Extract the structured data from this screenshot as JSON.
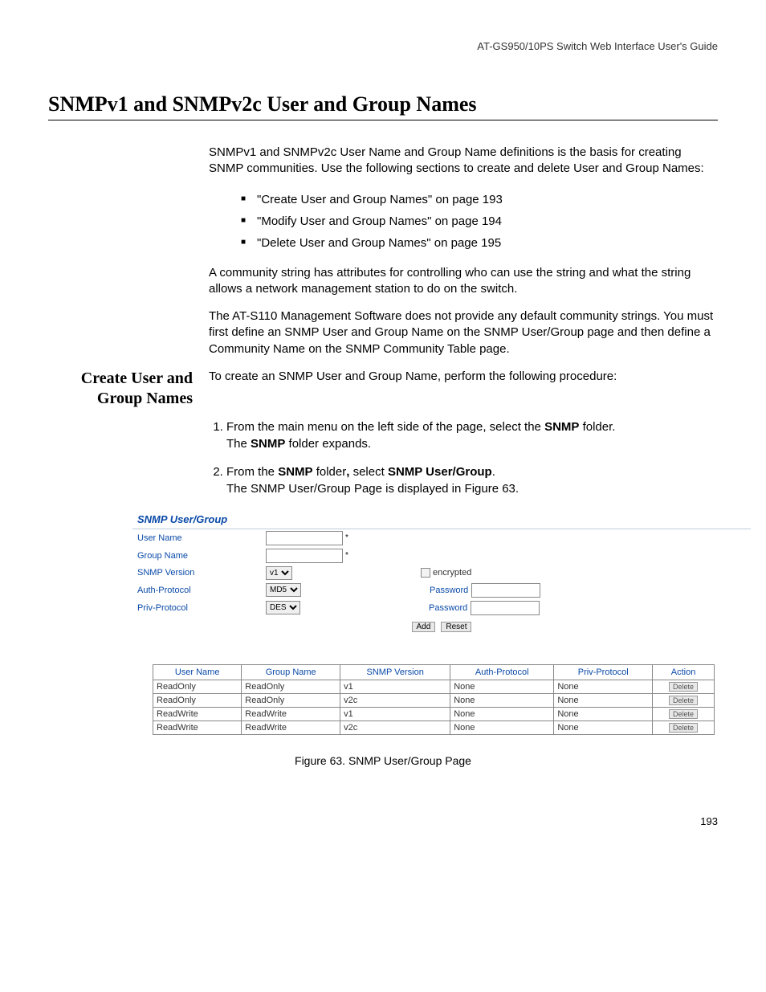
{
  "header": "AT-GS950/10PS Switch Web Interface User's Guide",
  "title": "SNMPv1 and SNMPv2c User and Group Names",
  "intro": "SNMPv1 and SNMPv2c User Name and Group Name definitions is the basis for creating SNMP communities. Use the following sections to create and delete User and Group Names:",
  "bullets": [
    "\"Create User and Group Names\" on page 193",
    "\"Modify User and Group Names\" on page 194",
    "\"Delete User and Group Names\" on page 195"
  ],
  "para2": "A community string has attributes for controlling who can use the string and what the string allows a network management station to do on the switch.",
  "para3": "The AT-S110 Management Software does not provide any default community strings. You must first define an SNMP User and Group Name on the SNMP User/Group page and then define a Community Name on the SNMP Community Table page.",
  "sub_heading": "Create User and Group Names",
  "sub_intro": "To create an SNMP User and Group Name, perform the following procedure:",
  "step1_a": "From the main menu on the left side of the page, select the ",
  "step1_bold1": "SNMP",
  "step1_b": " folder.",
  "step1_c": "The ",
  "step1_bold2": "SNMP",
  "step1_d": " folder expands.",
  "step2_a": "From the ",
  "step2_bold1": "SNMP",
  "step2_b": " folder",
  "step2_boldcomma": ",",
  "step2_c": " select ",
  "step2_bold2": "SNMP User/Group",
  "step2_d": ".",
  "step2_e": "The SNMP User/Group Page is displayed in Figure 63.",
  "shot": {
    "title": "SNMP User/Group",
    "labels": {
      "user": "User Name",
      "group": "Group Name",
      "version": "SNMP Version",
      "auth": "Auth-Protocol",
      "priv": "Priv-Protocol",
      "encrypted": "encrypted",
      "password": "Password"
    },
    "selects": {
      "version": "v1",
      "auth": "MD5",
      "priv": "DES"
    },
    "buttons": {
      "add": "Add",
      "reset": "Reset"
    }
  },
  "table": {
    "headers": [
      "User Name",
      "Group Name",
      "SNMP Version",
      "Auth-Protocol",
      "Priv-Protocol",
      "Action"
    ],
    "rows": [
      [
        "ReadOnly",
        "ReadOnly",
        "v1",
        "None",
        "None"
      ],
      [
        "ReadOnly",
        "ReadOnly",
        "v2c",
        "None",
        "None"
      ],
      [
        "ReadWrite",
        "ReadWrite",
        "v1",
        "None",
        "None"
      ],
      [
        "ReadWrite",
        "ReadWrite",
        "v2c",
        "None",
        "None"
      ]
    ],
    "delete": "Delete"
  },
  "caption": "Figure 63. SNMP User/Group Page",
  "page_number": "193"
}
